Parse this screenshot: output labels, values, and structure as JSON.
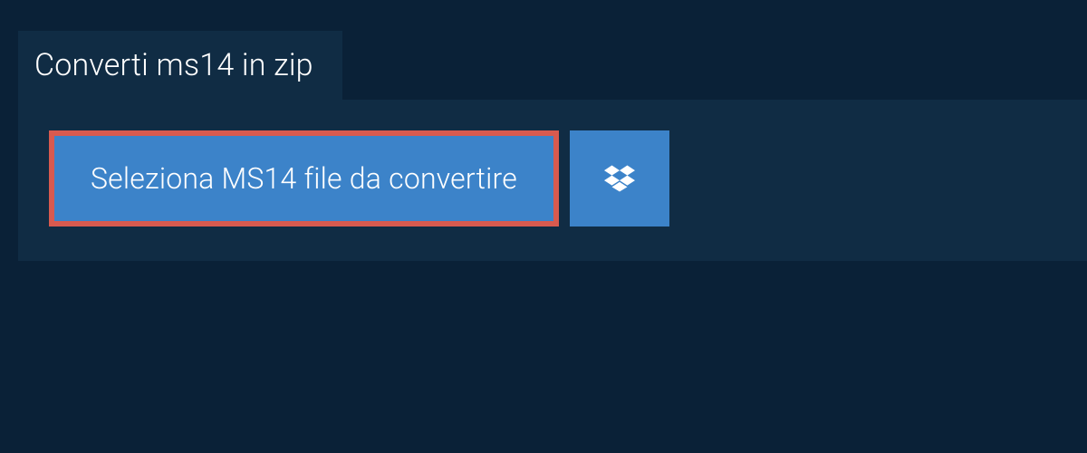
{
  "tab": {
    "title": "Converti ms14 in zip"
  },
  "upload": {
    "select_label": "Seleziona MS14 file da convertire"
  }
}
